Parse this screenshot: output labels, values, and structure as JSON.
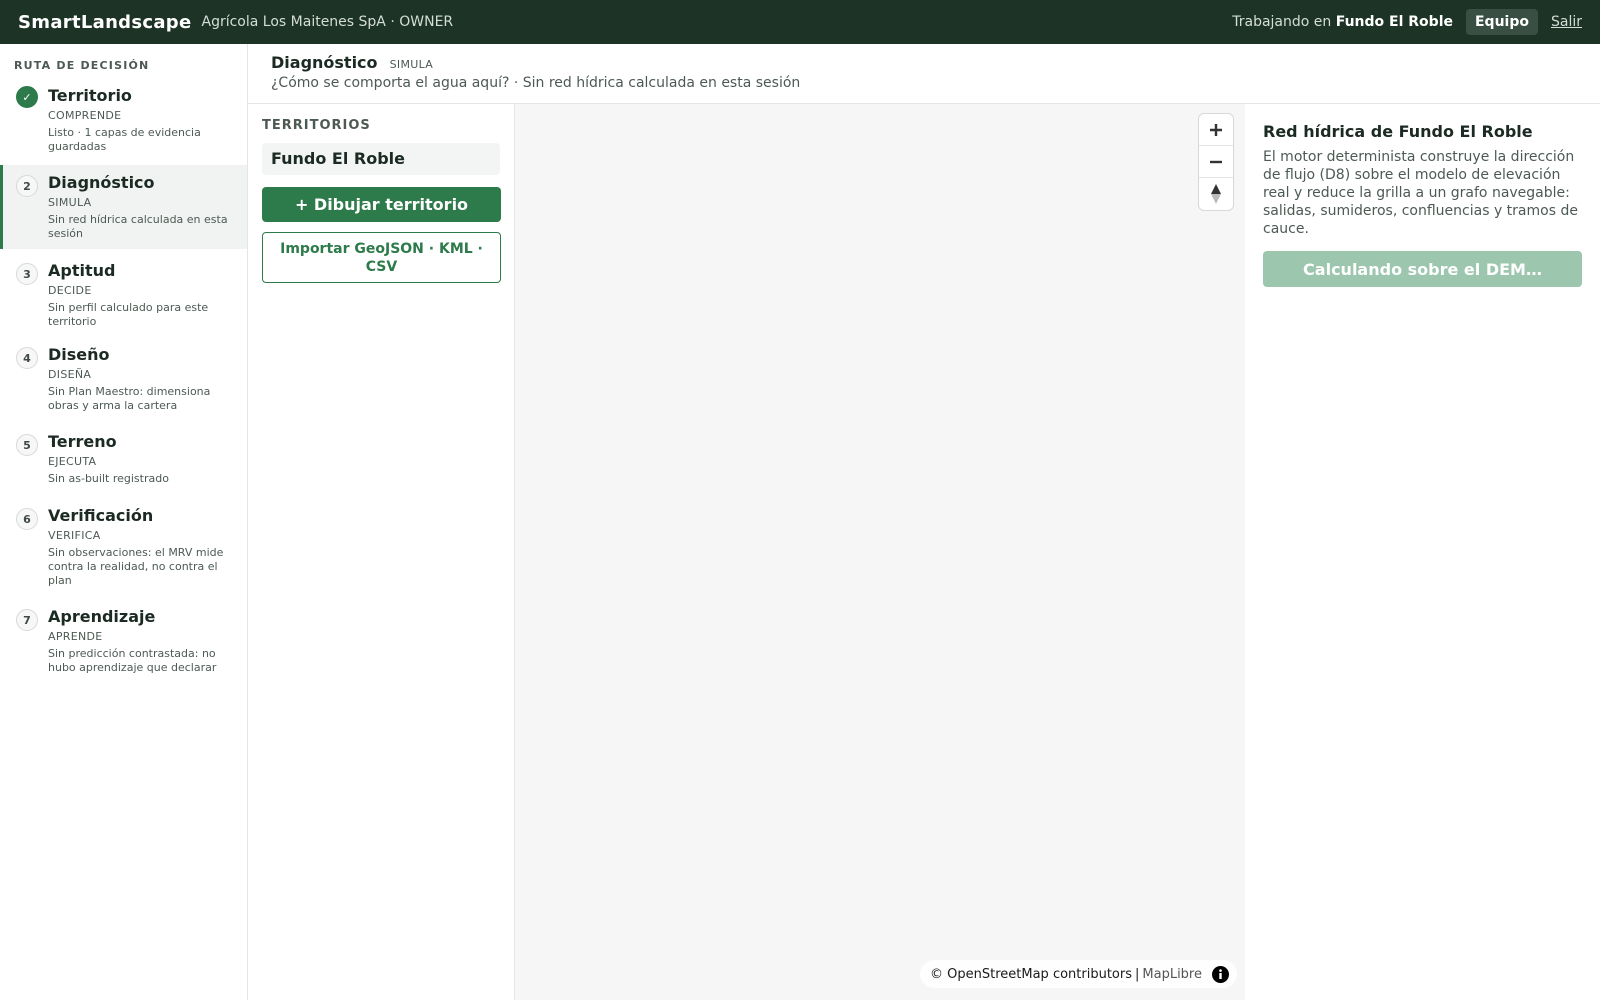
{
  "app": {
    "brand": "SmartLandscape",
    "org": "Agrícola Los Maitenes SpA · OWNER",
    "working_prefix": "Trabajando en",
    "working_in": "Fundo El Roble",
    "equipo_label": "Equipo",
    "salir_label": "Salir"
  },
  "sidebar": {
    "title": "RUTA DE DECISIÓN",
    "steps": [
      {
        "badge": "✓",
        "title": "Territorio",
        "kicker": "COMPRENDE",
        "desc": "Listo · 1 capas de evidencia guardadas",
        "state": "done"
      },
      {
        "badge": "2",
        "title": "Diagnóstico",
        "kicker": "SIMULA",
        "desc": "Sin red hídrica calculada en esta sesión",
        "state": "active"
      },
      {
        "badge": "3",
        "title": "Aptitud",
        "kicker": "DECIDE",
        "desc": "Sin perfil calculado para este territorio",
        "state": "pending"
      },
      {
        "badge": "4",
        "title": "Diseño",
        "kicker": "DISEÑA",
        "desc": "Sin Plan Maestro: dimensiona obras y arma la cartera",
        "state": "pending"
      },
      {
        "badge": "5",
        "title": "Terreno",
        "kicker": "EJECUTA",
        "desc": "Sin as-built registrado",
        "state": "pending"
      },
      {
        "badge": "6",
        "title": "Verificación",
        "kicker": "VERIFICA",
        "desc": "Sin observaciones: el MRV mide contra la realidad, no contra el plan",
        "state": "pending"
      },
      {
        "badge": "7",
        "title": "Aprendizaje",
        "kicker": "APRENDE",
        "desc": "Sin predicción contrastada: no hubo aprendizaje que declarar",
        "state": "pending"
      }
    ]
  },
  "header": {
    "title": "Diagnóstico",
    "kicker": "SIMULA",
    "subtitle": "¿Cómo se comporta el agua aquí? · Sin red hídrica calculada en esta sesión"
  },
  "territories": {
    "label": "TERRITORIOS",
    "items": [
      "Fundo El Roble"
    ],
    "draw_button": "+ Dibujar territorio",
    "import_button": "Importar GeoJSON · KML · CSV"
  },
  "map": {
    "attribution_osm": "© OpenStreetMap contributors",
    "attribution_sep": "|",
    "attribution_lib": "MapLibre",
    "icons": [
      "plus-icon",
      "minus-icon",
      "compass-icon",
      "info-icon"
    ]
  },
  "panel": {
    "title": "Red hídrica de Fundo El Roble",
    "description": "El motor determinista construye la dirección de flujo (D8) sobre el modelo de elevación real y reduce la grilla a un grafo navegable: salidas, sumideros, confluencias y tramos de cauce.",
    "button": "Calculando sobre el DEM…"
  },
  "colors": {
    "topbar": "#1c3326",
    "accent": "#2d7a4a",
    "accent_disabled": "#9cc6ad",
    "map_bg": "#f5f6f5"
  }
}
